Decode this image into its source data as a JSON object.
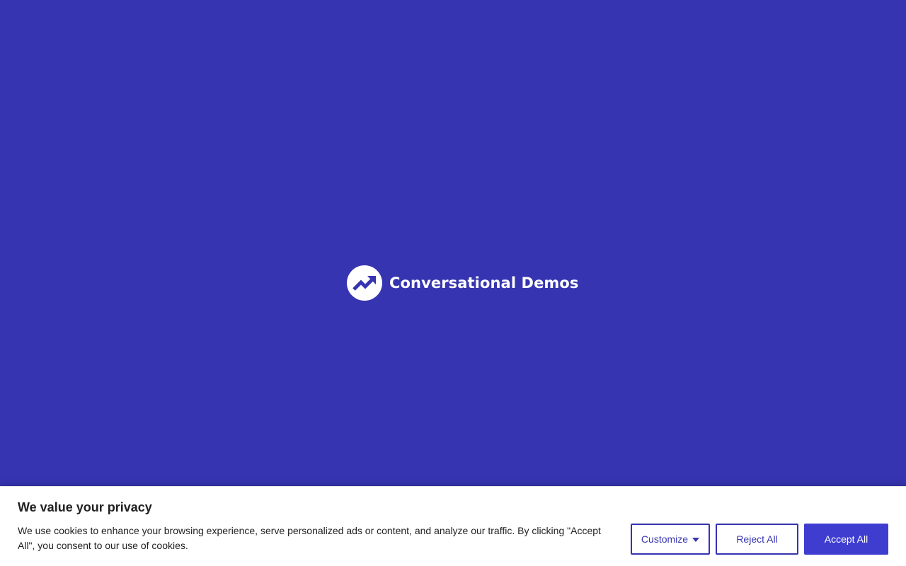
{
  "brand": {
    "name": "Conversational Demos",
    "logo_icon": "trending-up-icon"
  },
  "cookie_banner": {
    "title": "We value your privacy",
    "text": "We use cookies to enhance your browsing experience, serve personalized ads or content, and analyze our traffic. By clicking \"Accept All\", you consent to our use of cookies.",
    "buttons": {
      "customize": "Customize",
      "reject": "Reject All",
      "accept": "Accept All"
    }
  },
  "colors": {
    "background": "#3634b0",
    "accent": "#3f3dd0",
    "banner_background": "#ffffff",
    "text": "#212121"
  }
}
